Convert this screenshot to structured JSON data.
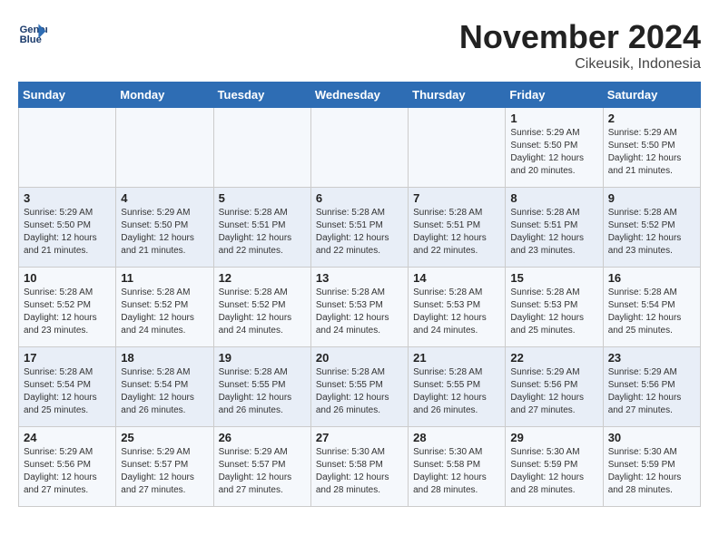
{
  "header": {
    "logo_line1": "General",
    "logo_line2": "Blue",
    "month": "November 2024",
    "location": "Cikeusik, Indonesia"
  },
  "weekdays": [
    "Sunday",
    "Monday",
    "Tuesday",
    "Wednesday",
    "Thursday",
    "Friday",
    "Saturday"
  ],
  "weeks": [
    [
      {
        "day": "",
        "info": ""
      },
      {
        "day": "",
        "info": ""
      },
      {
        "day": "",
        "info": ""
      },
      {
        "day": "",
        "info": ""
      },
      {
        "day": "",
        "info": ""
      },
      {
        "day": "1",
        "info": "Sunrise: 5:29 AM\nSunset: 5:50 PM\nDaylight: 12 hours\nand 20 minutes."
      },
      {
        "day": "2",
        "info": "Sunrise: 5:29 AM\nSunset: 5:50 PM\nDaylight: 12 hours\nand 21 minutes."
      }
    ],
    [
      {
        "day": "3",
        "info": "Sunrise: 5:29 AM\nSunset: 5:50 PM\nDaylight: 12 hours\nand 21 minutes."
      },
      {
        "day": "4",
        "info": "Sunrise: 5:29 AM\nSunset: 5:50 PM\nDaylight: 12 hours\nand 21 minutes."
      },
      {
        "day": "5",
        "info": "Sunrise: 5:28 AM\nSunset: 5:51 PM\nDaylight: 12 hours\nand 22 minutes."
      },
      {
        "day": "6",
        "info": "Sunrise: 5:28 AM\nSunset: 5:51 PM\nDaylight: 12 hours\nand 22 minutes."
      },
      {
        "day": "7",
        "info": "Sunrise: 5:28 AM\nSunset: 5:51 PM\nDaylight: 12 hours\nand 22 minutes."
      },
      {
        "day": "8",
        "info": "Sunrise: 5:28 AM\nSunset: 5:51 PM\nDaylight: 12 hours\nand 23 minutes."
      },
      {
        "day": "9",
        "info": "Sunrise: 5:28 AM\nSunset: 5:52 PM\nDaylight: 12 hours\nand 23 minutes."
      }
    ],
    [
      {
        "day": "10",
        "info": "Sunrise: 5:28 AM\nSunset: 5:52 PM\nDaylight: 12 hours\nand 23 minutes."
      },
      {
        "day": "11",
        "info": "Sunrise: 5:28 AM\nSunset: 5:52 PM\nDaylight: 12 hours\nand 24 minutes."
      },
      {
        "day": "12",
        "info": "Sunrise: 5:28 AM\nSunset: 5:52 PM\nDaylight: 12 hours\nand 24 minutes."
      },
      {
        "day": "13",
        "info": "Sunrise: 5:28 AM\nSunset: 5:53 PM\nDaylight: 12 hours\nand 24 minutes."
      },
      {
        "day": "14",
        "info": "Sunrise: 5:28 AM\nSunset: 5:53 PM\nDaylight: 12 hours\nand 24 minutes."
      },
      {
        "day": "15",
        "info": "Sunrise: 5:28 AM\nSunset: 5:53 PM\nDaylight: 12 hours\nand 25 minutes."
      },
      {
        "day": "16",
        "info": "Sunrise: 5:28 AM\nSunset: 5:54 PM\nDaylight: 12 hours\nand 25 minutes."
      }
    ],
    [
      {
        "day": "17",
        "info": "Sunrise: 5:28 AM\nSunset: 5:54 PM\nDaylight: 12 hours\nand 25 minutes."
      },
      {
        "day": "18",
        "info": "Sunrise: 5:28 AM\nSunset: 5:54 PM\nDaylight: 12 hours\nand 26 minutes."
      },
      {
        "day": "19",
        "info": "Sunrise: 5:28 AM\nSunset: 5:55 PM\nDaylight: 12 hours\nand 26 minutes."
      },
      {
        "day": "20",
        "info": "Sunrise: 5:28 AM\nSunset: 5:55 PM\nDaylight: 12 hours\nand 26 minutes."
      },
      {
        "day": "21",
        "info": "Sunrise: 5:28 AM\nSunset: 5:55 PM\nDaylight: 12 hours\nand 26 minutes."
      },
      {
        "day": "22",
        "info": "Sunrise: 5:29 AM\nSunset: 5:56 PM\nDaylight: 12 hours\nand 27 minutes."
      },
      {
        "day": "23",
        "info": "Sunrise: 5:29 AM\nSunset: 5:56 PM\nDaylight: 12 hours\nand 27 minutes."
      }
    ],
    [
      {
        "day": "24",
        "info": "Sunrise: 5:29 AM\nSunset: 5:56 PM\nDaylight: 12 hours\nand 27 minutes."
      },
      {
        "day": "25",
        "info": "Sunrise: 5:29 AM\nSunset: 5:57 PM\nDaylight: 12 hours\nand 27 minutes."
      },
      {
        "day": "26",
        "info": "Sunrise: 5:29 AM\nSunset: 5:57 PM\nDaylight: 12 hours\nand 27 minutes."
      },
      {
        "day": "27",
        "info": "Sunrise: 5:30 AM\nSunset: 5:58 PM\nDaylight: 12 hours\nand 28 minutes."
      },
      {
        "day": "28",
        "info": "Sunrise: 5:30 AM\nSunset: 5:58 PM\nDaylight: 12 hours\nand 28 minutes."
      },
      {
        "day": "29",
        "info": "Sunrise: 5:30 AM\nSunset: 5:59 PM\nDaylight: 12 hours\nand 28 minutes."
      },
      {
        "day": "30",
        "info": "Sunrise: 5:30 AM\nSunset: 5:59 PM\nDaylight: 12 hours\nand 28 minutes."
      }
    ]
  ]
}
